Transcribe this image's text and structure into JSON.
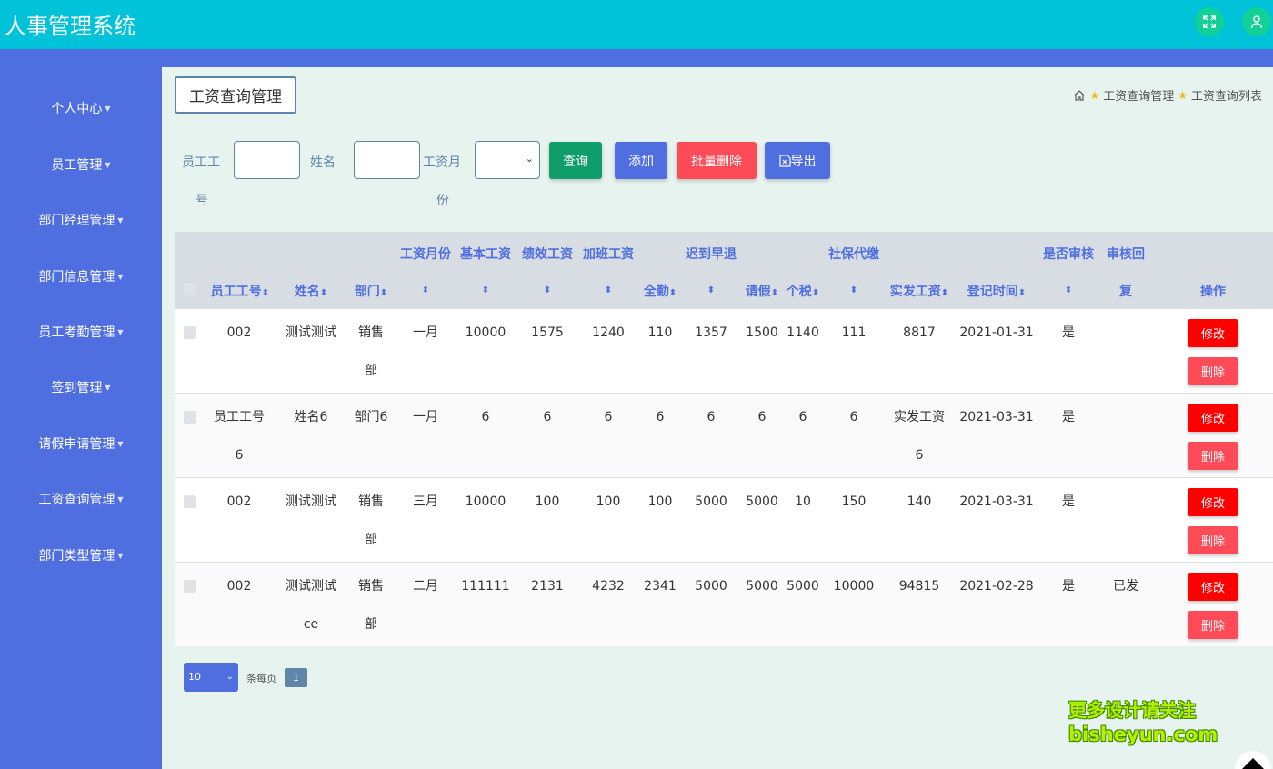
{
  "app": {
    "title": "人事管理系统"
  },
  "header": {
    "fullscreen_icon": "fullscreen-icon",
    "user_icon": "user-icon"
  },
  "sidebar": {
    "items": [
      {
        "label": "个人中心"
      },
      {
        "label": "员工管理"
      },
      {
        "label": "部门经理管理"
      },
      {
        "label": "部门信息管理"
      },
      {
        "label": "员工考勤管理"
      },
      {
        "label": "签到管理"
      },
      {
        "label": "请假申请管理"
      },
      {
        "label": "工资查询管理"
      },
      {
        "label": "部门类型管理"
      }
    ]
  },
  "page": {
    "title": "工资查询管理"
  },
  "breadcrumb": {
    "items": [
      "工资查询管理",
      "工资查询列表"
    ]
  },
  "search": {
    "employee_no_label_1": "员工工",
    "employee_no_label_2": "号",
    "name_label": "姓名",
    "month_label_1": "工资月",
    "month_label_2": "份",
    "employee_no_value": "",
    "name_value": "",
    "month_value": ""
  },
  "toolbar": {
    "query": "查询",
    "add": "添加",
    "batch_delete": "批量删除",
    "export": "导出"
  },
  "table": {
    "headers": {
      "emp_no": "员工工号",
      "name": "姓名",
      "dept": "部门",
      "month": "工资月份",
      "base": "基本工资",
      "perf": "绩效工资",
      "ot": "加班工资",
      "attend": "全勤",
      "late": "迟到早退",
      "leave": "请假",
      "tax": "个税",
      "social": "社保代缴",
      "net": "实发工资",
      "reg_time": "登记时间",
      "audited": "是否审核",
      "reply_1": "审核回",
      "reply_2": "复",
      "ops": "操作"
    },
    "rows": [
      {
        "emp_no": "002",
        "name": "测试测试",
        "dept_1": "销售",
        "dept_2": "部",
        "month": "一月",
        "base": "10000",
        "perf": "1575",
        "ot": "1240",
        "attend": "110",
        "late": "1357",
        "leave": "1500",
        "tax": "1140",
        "social": "111",
        "net": "8817",
        "reg_time": "2021-01-31",
        "audited": "是",
        "reply": ""
      },
      {
        "emp_no": "员工工号",
        "emp_no_2": "6",
        "name": "姓名6",
        "dept_1": "部门6",
        "month": "一月",
        "base": "6",
        "perf": "6",
        "ot": "6",
        "attend": "6",
        "late": "6",
        "leave": "6",
        "tax": "6",
        "social": "6",
        "net": "实发工资",
        "net_2": "6",
        "reg_time": "2021-03-31",
        "audited": "是",
        "reply": ""
      },
      {
        "emp_no": "002",
        "name": "测试测试",
        "dept_1": "销售",
        "dept_2": "部",
        "month": "三月",
        "base": "10000",
        "perf": "100",
        "ot": "100",
        "attend": "100",
        "late": "5000",
        "leave": "5000",
        "tax": "10",
        "social": "150",
        "net": "140",
        "reg_time": "2021-03-31",
        "audited": "是",
        "reply": ""
      },
      {
        "emp_no": "002",
        "name": "测试测试",
        "name_2": "ce",
        "dept_1": "销售",
        "dept_2": "部",
        "month": "二月",
        "base": "111111",
        "perf": "2131",
        "ot": "4232",
        "attend": "2341",
        "late": "5000",
        "leave": "5000",
        "tax": "5000",
        "social": "10000",
        "net": "94815",
        "reg_time": "2021-02-28",
        "audited": "是",
        "reply": "已发"
      }
    ],
    "edit_label": "修改",
    "delete_label": "删除"
  },
  "pagination": {
    "page_size": "10",
    "per_page_label": "条每页",
    "current_page": "1"
  },
  "watermark": {
    "line1": "更多设计请关注",
    "line2": "bisheyun.com"
  }
}
